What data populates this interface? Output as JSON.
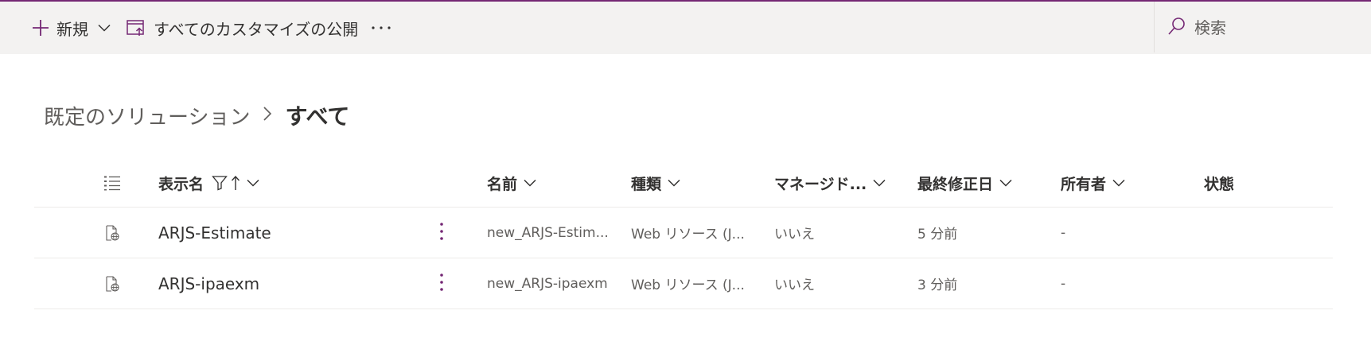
{
  "toolbar": {
    "new_label": "新規",
    "publish_label": "すべてのカスタマイズの公開",
    "overflow_label": "···",
    "search_placeholder": "検索"
  },
  "breadcrumb": {
    "parent": "既定のソリューション",
    "separator": ">",
    "current": "すべて"
  },
  "table": {
    "columns": [
      "表示名",
      "名前",
      "種類",
      "マネージド...",
      "最終修正日",
      "所有者",
      "状態"
    ],
    "rows": [
      {
        "display_name": "ARJS-Estimate",
        "name": "new_ARJS-Estim...",
        "type": "Web リソース (J...",
        "managed": "いいえ",
        "modified": "5 分前",
        "owner": "-",
        "status": ""
      },
      {
        "display_name": "ARJS-ipaexm",
        "name": "new_ARJS-ipaexm",
        "type": "Web リソース (J...",
        "managed": "いいえ",
        "modified": "3 分前",
        "owner": "-",
        "status": ""
      }
    ]
  },
  "colors": {
    "accent": "#742774",
    "command_bar_bg": "#f3f2f1",
    "text": "#323130",
    "muted_text": "#605e5c",
    "divider": "#edebe9"
  },
  "icons": {
    "new": "plus-icon",
    "new_dropdown": "chevron-down-icon",
    "publish": "publish-icon",
    "overflow": "more-icon",
    "search": "search-icon",
    "list": "list-icon",
    "filter": "filter-icon",
    "sort": "sort-ascending-icon",
    "row_type": "web-resource-icon",
    "row_menu": "more-vertical-icon"
  }
}
